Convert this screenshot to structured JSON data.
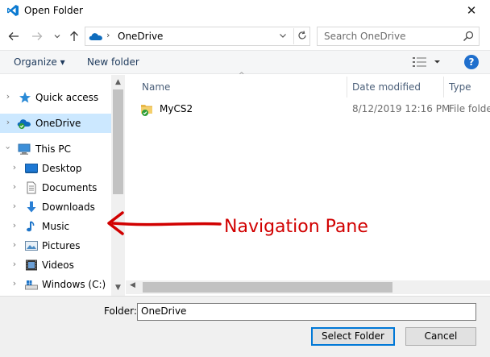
{
  "window": {
    "title": "Open Folder",
    "close_glyph": "✕"
  },
  "address": {
    "path": "OneDrive",
    "search_placeholder": "Search OneDrive"
  },
  "toolbar": {
    "organize_label": "Organize ▾",
    "new_folder_label": "New folder"
  },
  "nav": {
    "items": [
      {
        "label": "Quick access",
        "icon": "star-icon"
      },
      {
        "label": "OneDrive",
        "icon": "onedrive-icon",
        "selected": true
      },
      {
        "label": "This PC",
        "icon": "pc-icon"
      },
      {
        "label": "Desktop",
        "icon": "desktop-icon"
      },
      {
        "label": "Documents",
        "icon": "documents-icon"
      },
      {
        "label": "Downloads",
        "icon": "downloads-icon"
      },
      {
        "label": "Music",
        "icon": "music-icon"
      },
      {
        "label": "Pictures",
        "icon": "pictures-icon"
      },
      {
        "label": "Videos",
        "icon": "videos-icon"
      },
      {
        "label": "Windows (C:)",
        "icon": "drive-icon"
      }
    ]
  },
  "files": {
    "columns": {
      "name": "Name",
      "date": "Date modified",
      "type": "Type"
    },
    "rows": [
      {
        "name": "MyCS2",
        "date": "8/12/2019 12:16 PM",
        "type": "File folder"
      }
    ]
  },
  "footer": {
    "folder_label": "Folder:",
    "folder_value": "OneDrive",
    "select_label": "Select Folder",
    "cancel_label": "Cancel"
  },
  "annotation": {
    "text": "Navigation Pane"
  },
  "colors": {
    "annotation": "#d10000",
    "selection": "#cce8ff",
    "accent": "#0078d7"
  }
}
